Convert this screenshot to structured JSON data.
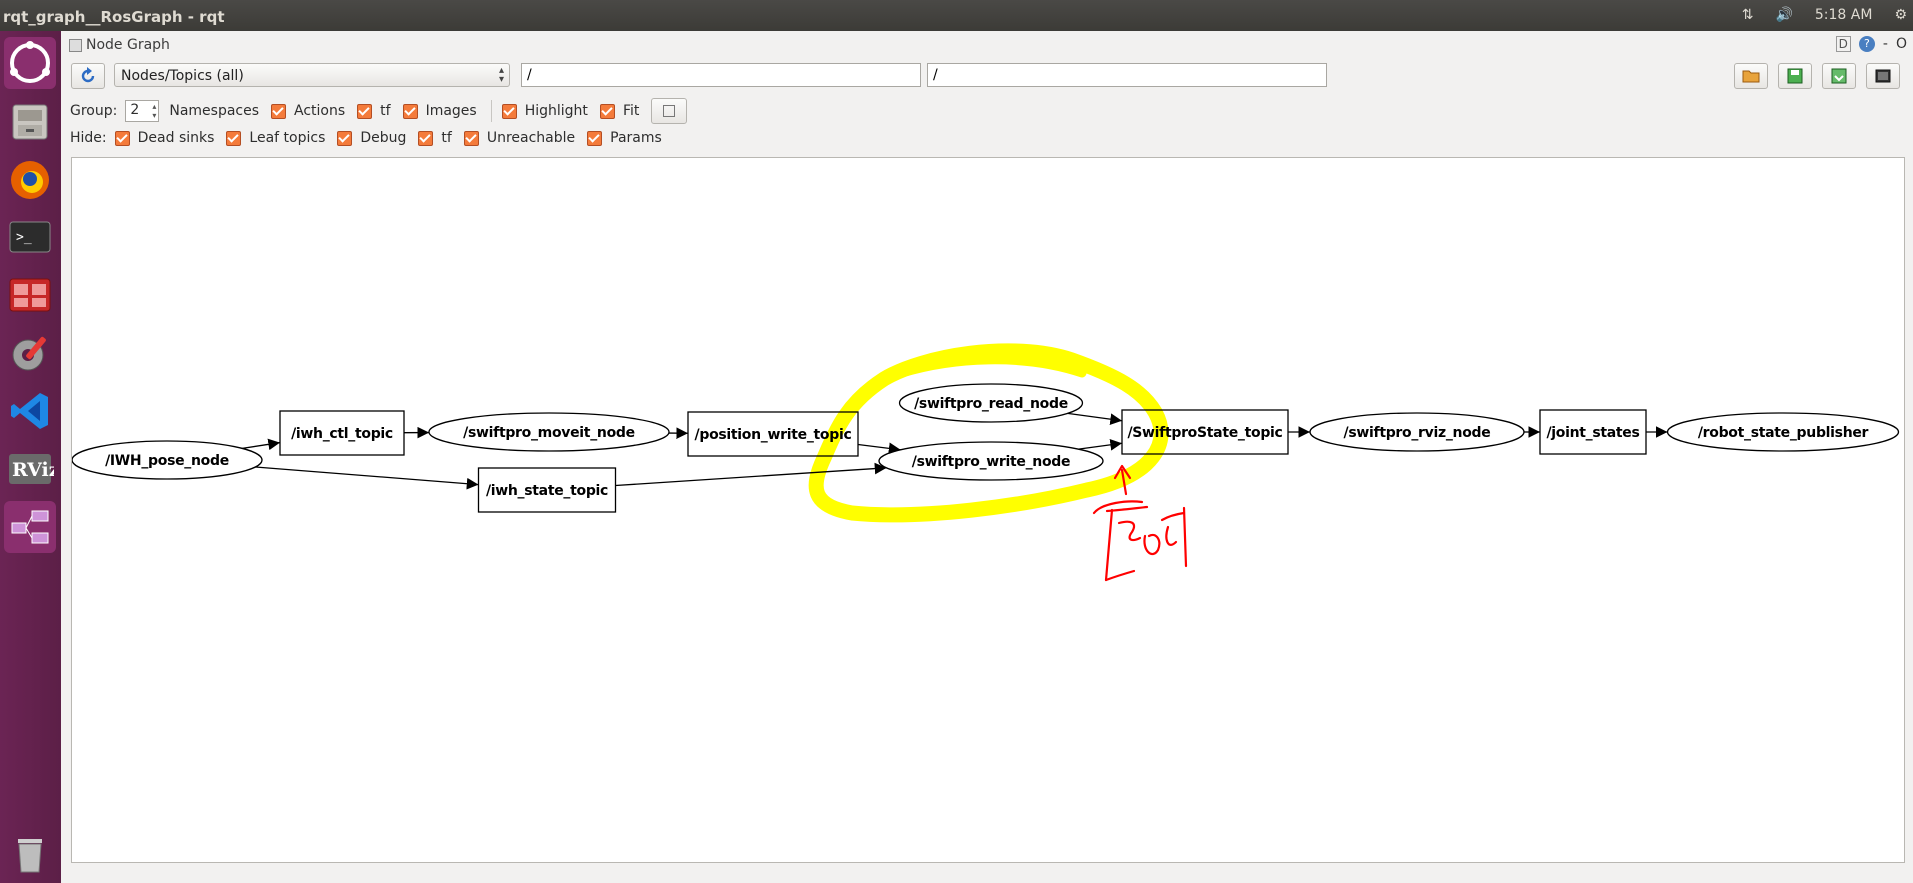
{
  "window": {
    "title": "rqt_graph__RosGraph - rqt"
  },
  "system_tray": {
    "time": "5:18 AM"
  },
  "plugin": {
    "title": "Node Graph",
    "dock_label": "D",
    "help_label": "?",
    "minimize_label": "-",
    "close_label": "O"
  },
  "toolbar": {
    "graph_type": "Nodes/Topics (all)",
    "node_filter": "/",
    "topic_filter": "/"
  },
  "group_row": {
    "group_label": "Group:",
    "group_value": "2",
    "options": [
      {
        "label": "Namespaces",
        "checked": false
      },
      {
        "label": "Actions",
        "checked": true
      },
      {
        "label": "tf",
        "checked": true
      },
      {
        "label": "Images",
        "checked": true
      },
      {
        "label": "Highlight",
        "checked": true
      },
      {
        "label": "Fit",
        "checked": true
      }
    ]
  },
  "hide_row": {
    "hide_label": "Hide:",
    "options": [
      {
        "label": "Dead sinks",
        "checked": true
      },
      {
        "label": "Leaf topics",
        "checked": true
      },
      {
        "label": "Debug",
        "checked": true
      },
      {
        "label": "tf",
        "checked": true
      },
      {
        "label": "Unreachable",
        "checked": true
      },
      {
        "label": "Params",
        "checked": true
      }
    ]
  },
  "graph": {
    "nodes": [
      {
        "id": "iwh_pose_node",
        "label": "/IWH_pose_node",
        "kind": "node"
      },
      {
        "id": "iwh_ctl_topic",
        "label": "/iwh_ctl_topic",
        "kind": "topic"
      },
      {
        "id": "swiftpro_moveit_node",
        "label": "/swiftpro_moveit_node",
        "kind": "node"
      },
      {
        "id": "position_write_topic",
        "label": "/position_write_topic",
        "kind": "topic"
      },
      {
        "id": "iwh_state_topic",
        "label": "/iwh_state_topic",
        "kind": "topic"
      },
      {
        "id": "swiftpro_read_node",
        "label": "/swiftpro_read_node",
        "kind": "node"
      },
      {
        "id": "swiftpro_write_node",
        "label": "/swiftpro_write_node",
        "kind": "node"
      },
      {
        "id": "swiftprostate_topic",
        "label": "/SwiftproState_topic",
        "kind": "topic"
      },
      {
        "id": "swiftpro_rviz_node",
        "label": "/swiftpro_rviz_node",
        "kind": "node"
      },
      {
        "id": "joint_states",
        "label": "/joint_states",
        "kind": "topic"
      },
      {
        "id": "robot_state_publisher",
        "label": "/robot_state_publisher",
        "kind": "node"
      }
    ],
    "edges": [
      [
        "iwh_pose_node",
        "iwh_ctl_topic"
      ],
      [
        "iwh_ctl_topic",
        "swiftpro_moveit_node"
      ],
      [
        "swiftpro_moveit_node",
        "position_write_topic"
      ],
      [
        "position_write_topic",
        "swiftpro_write_node"
      ],
      [
        "iwh_pose_node",
        "iwh_state_topic"
      ],
      [
        "iwh_state_topic",
        "swiftpro_write_node"
      ],
      [
        "swiftpro_read_node",
        "swiftprostate_topic"
      ],
      [
        "swiftpro_write_node",
        "swiftprostate_topic"
      ],
      [
        "swiftprostate_topic",
        "swiftpro_rviz_node"
      ],
      [
        "swiftpro_rviz_node",
        "joint_states"
      ],
      [
        "joint_states",
        "robot_state_publisher"
      ]
    ]
  },
  "annotations": {
    "highlight_color": "#ffff00",
    "ink_color": "#ff0000"
  },
  "colors": {
    "checkbox_accent": "#f47b3b",
    "launcher": "#5c1f47"
  }
}
